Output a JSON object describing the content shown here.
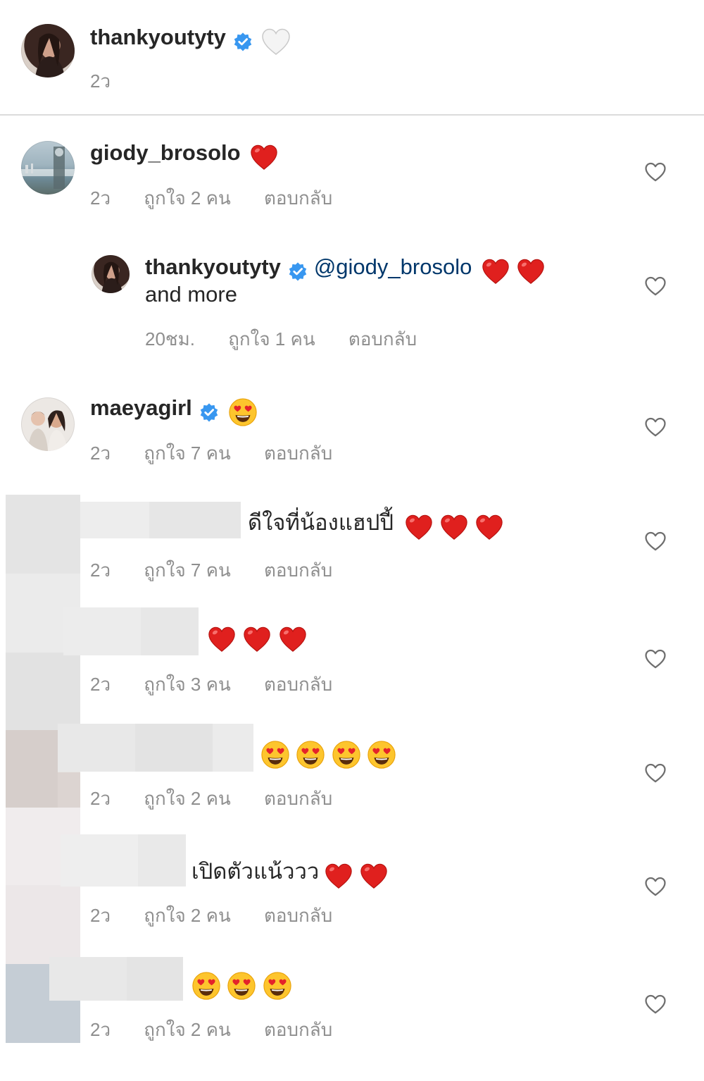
{
  "caption": {
    "username": "thankyoutyty",
    "time": "2ว"
  },
  "comments": [
    {
      "username": "giody_brosolo",
      "time": "2ว",
      "likes": "ถูกใจ 2 คน",
      "reply": "ตอบกลับ"
    },
    {
      "username": "thankyoutyty",
      "mention": "@giody_brosolo",
      "text_line2": "and more",
      "time": "20ชม.",
      "likes": "ถูกใจ 1 คน",
      "reply": "ตอบกลับ"
    },
    {
      "username": "maeyagirl",
      "time": "2ว",
      "likes": "ถูกใจ 7 คน",
      "reply": "ตอบกลับ"
    },
    {
      "text": "ดีใจที่น้องแฮปปี้",
      "time": "2ว",
      "likes": "ถูกใจ 7 คน",
      "reply": "ตอบกลับ"
    },
    {
      "time": "2ว",
      "likes": "ถูกใจ 3 คน",
      "reply": "ตอบกลับ"
    },
    {
      "time": "2ว",
      "likes": "ถูกใจ 2 คน",
      "reply": "ตอบกลับ"
    },
    {
      "text": "เปิดตัวแน้ววว",
      "time": "2ว",
      "likes": "ถูกใจ 2 คน",
      "reply": "ตอบกลับ"
    },
    {
      "time": "2ว",
      "likes": "ถูกใจ 2 คน",
      "reply": "ตอบกลับ"
    }
  ],
  "colors": {
    "verified_blue": "#3897f0",
    "heart_red": "#e0201e",
    "meta_gray": "#8e8e8e",
    "mention_blue": "#00376b"
  },
  "icons": [
    "verified-badge-icon",
    "white-heart-emoji-icon",
    "red-heart-emoji-icon",
    "heart-eyes-emoji-icon",
    "like-heart-outline-icon"
  ]
}
